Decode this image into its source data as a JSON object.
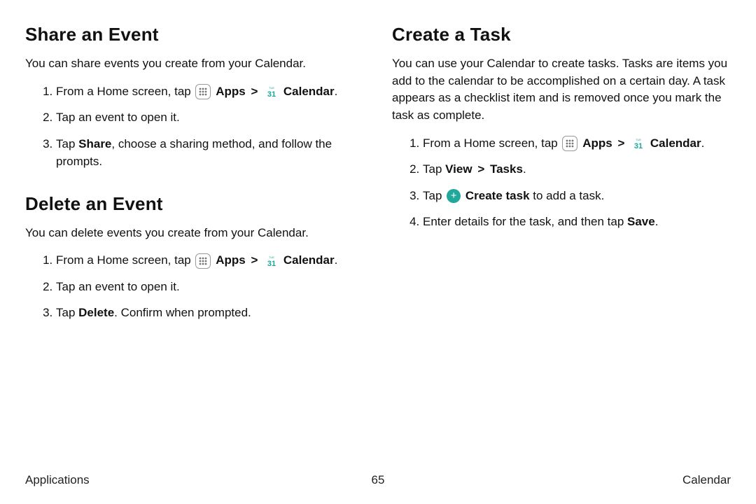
{
  "left": {
    "share": {
      "title": "Share an Event",
      "intro": "You can share events you create from your Calendar.",
      "step1_a": "From a Home screen, tap",
      "apps_label": "Apps",
      "calendar_label": "Calendar",
      "period": ".",
      "step2": "Tap an event to open it.",
      "step3_a": "Tap ",
      "step3_b": "Share",
      "step3_c": ", choose a sharing method, and follow the prompts."
    },
    "delete": {
      "title": "Delete an Event",
      "intro": "You can delete events you create from your Calendar.",
      "step1_a": "From a Home screen, tap",
      "apps_label": "Apps",
      "calendar_label": "Calendar",
      "period": ".",
      "step2": "Tap an event to open it.",
      "step3_a": "Tap ",
      "step3_b": "Delete",
      "step3_c": ". Confirm when prompted."
    }
  },
  "right": {
    "task": {
      "title": "Create a Task",
      "intro": "You can use your Calendar to create tasks. Tasks are items you add to the calendar to be accomplished on a certain day. A task appears as a checklist item and is removed once you mark the task as complete.",
      "step1_a": "From a Home screen, tap",
      "apps_label": "Apps",
      "calendar_label": "Calendar",
      "period": ".",
      "step2_a": "Tap ",
      "step2_b": "View",
      "step2_c": "Tasks",
      "step3_a": "Tap ",
      "step3_b": "Create task",
      "step3_c": " to add a task.",
      "step4_a": "Enter details for the task, and then tap ",
      "step4_b": "Save",
      "step4_c": "."
    }
  },
  "footer": {
    "left": "Applications",
    "center": "65",
    "right": "Calendar"
  },
  "glyphs": {
    "chevron": ">",
    "plus": "+"
  }
}
